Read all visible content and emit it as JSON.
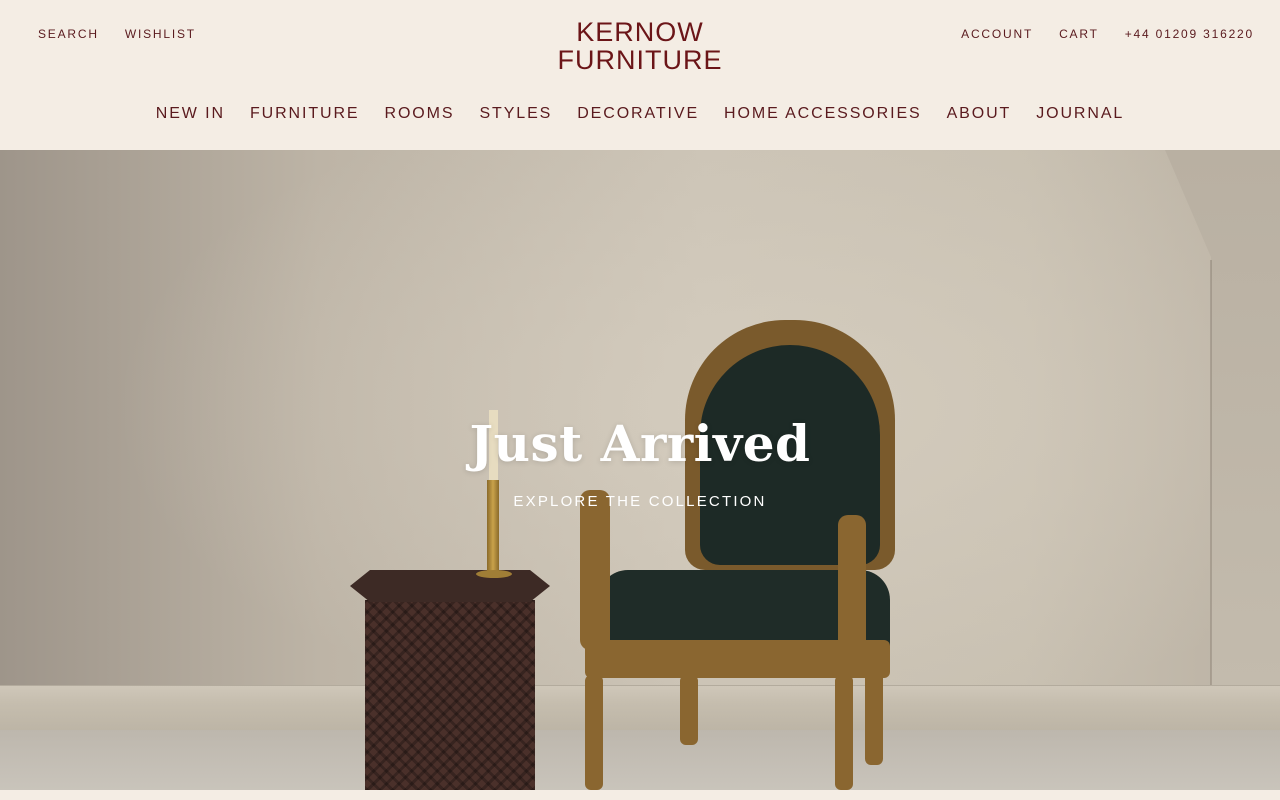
{
  "header": {
    "utility_left": [
      "SEARCH",
      "WISHLIST"
    ],
    "utility_right": [
      "ACCOUNT",
      "CART",
      "+44 01209 316220"
    ],
    "logo": {
      "line1": "KERNOW",
      "line2": "FURNITURE"
    }
  },
  "nav": {
    "items": [
      "NEW IN",
      "FURNITURE",
      "ROOMS",
      "STYLES",
      "DECORATIVE",
      "HOME ACCESSORIES",
      "ABOUT",
      "JOURNAL"
    ]
  },
  "hero": {
    "title": "Just Arrived",
    "cta": "EXPLORE THE COLLECTION"
  },
  "colors": {
    "background": "#f4ede4",
    "brand": "#6b1518",
    "text": "#5a1a1e",
    "hero_text": "#ffffff"
  }
}
